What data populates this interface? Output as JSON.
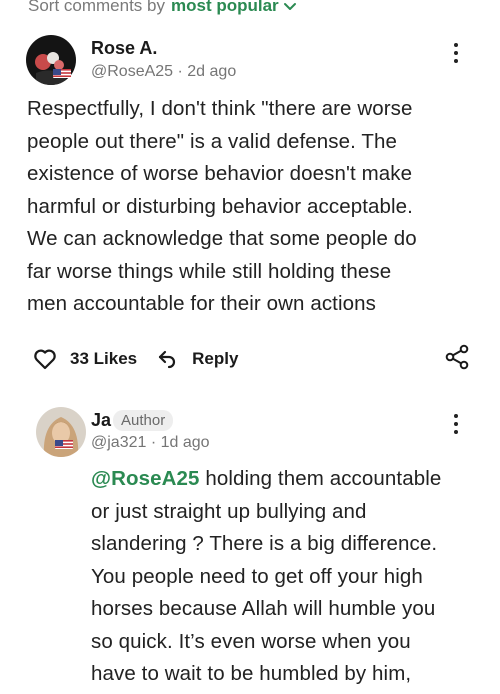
{
  "sort": {
    "label": "Sort comments by",
    "value": "most popular"
  },
  "comments": [
    {
      "name": "Rose A.",
      "handle": "@RoseA25",
      "time": "2d ago",
      "body_lines": [
        "Respectfully, I don't think \"there are worse",
        "people out there\" is a valid defense. The",
        "existence of worse behavior doesn't make",
        "harmful or disturbing behavior acceptable.",
        "We can acknowledge that some people do",
        "far worse things while still holding these",
        "men accountable for their own actions"
      ],
      "likes_label": "33 Likes",
      "reply_label": "Reply"
    },
    {
      "name": "Ja",
      "badge": "Author",
      "handle": "@ja321",
      "time": "1d ago",
      "mention": "@RoseA25",
      "body_lines": [
        " holding them accountable",
        "or just straight up bullying and",
        "slandering ? There is a big difference.",
        "You people need to get off your high",
        "horses because Allah will humble you",
        "so quick. It’s even worse when you",
        "have to wait to be humbled by him,"
      ]
    }
  ],
  "colors": {
    "accent": "#2b8a52",
    "muted": "#757575",
    "text": "#222222"
  },
  "icons": [
    "chevron-down-icon",
    "kebab-menu-icon",
    "heart-icon",
    "reply-icon",
    "share-icon",
    "us-flag-icon"
  ]
}
